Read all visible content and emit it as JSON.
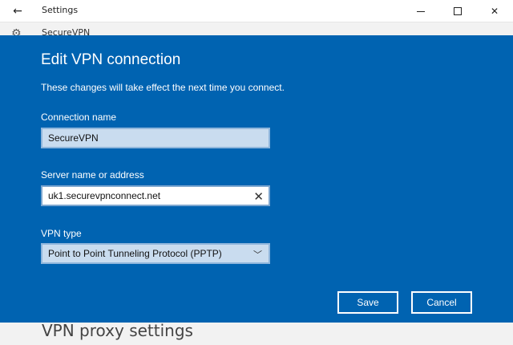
{
  "window": {
    "title": "Settings",
    "back_glyph": "←",
    "min_label": "",
    "close_glyph": "✕"
  },
  "background": {
    "top_item": "SecureVPN",
    "bottom_heading": "VPN proxy settings"
  },
  "dialog": {
    "title": "Edit VPN connection",
    "subtitle": "These changes will take effect the next time you connect.",
    "connection_name_label": "Connection name",
    "connection_name_value": "SecureVPN",
    "server_label": "Server name or address",
    "server_value": "uk1.securevpnconnect.net",
    "vpn_type_label": "VPN type",
    "vpn_type_value": "Point to Point Tunneling Protocol (PPTP)",
    "save_label": "Save",
    "cancel_label": "Cancel"
  },
  "colors": {
    "dialog_bg": "#0063b1",
    "field_bg": "#c9dcef",
    "text_on_dialog": "#ffffff"
  },
  "icons": {
    "back": "arrow-left-icon",
    "minimize": "minimize-icon",
    "maximize": "maximize-icon",
    "close": "close-icon",
    "clear": "clear-icon",
    "dropdown": "chevron-down-icon"
  }
}
